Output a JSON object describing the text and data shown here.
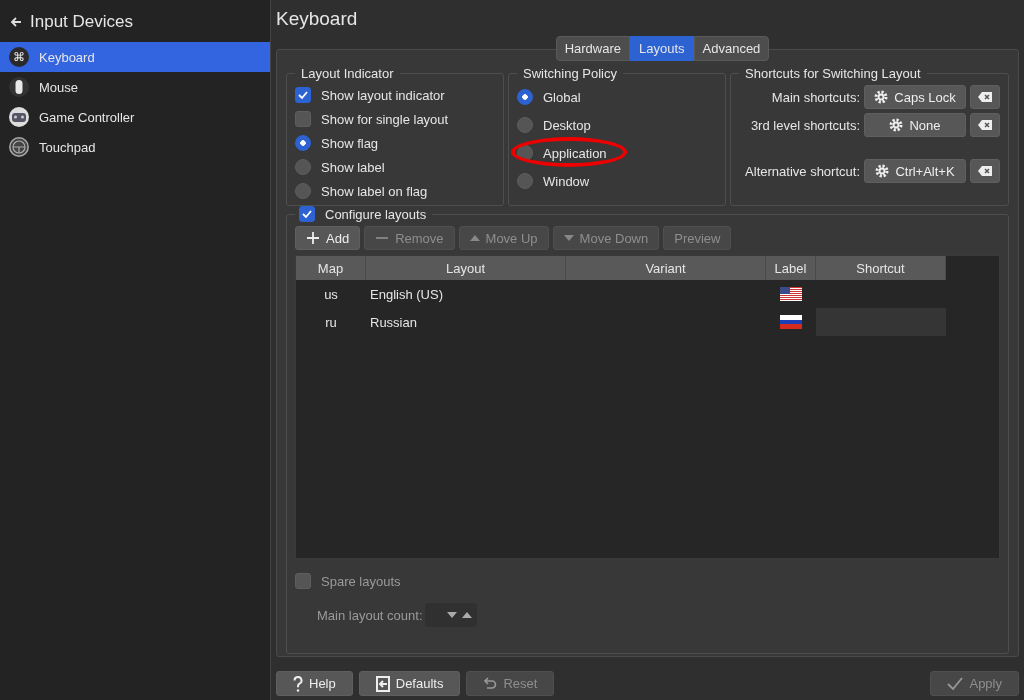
{
  "sidebar": {
    "back_title": "Input Devices",
    "items": [
      {
        "label": "Keyboard",
        "kind": "keyboard",
        "glyph": "⌘",
        "selected": true
      },
      {
        "label": "Mouse",
        "kind": "mouse",
        "selected": false
      },
      {
        "label": "Game Controller",
        "kind": "gamepad",
        "selected": false
      },
      {
        "label": "Touchpad",
        "kind": "touchpad",
        "selected": false
      }
    ]
  },
  "page_title": "Keyboard",
  "tabs": [
    {
      "label": "Hardware",
      "selected": false
    },
    {
      "label": "Layouts",
      "selected": true
    },
    {
      "label": "Advanced",
      "selected": false
    }
  ],
  "layout_indicator": {
    "title": "Layout Indicator",
    "options": [
      {
        "kind": "checkbox",
        "label": "Show layout indicator",
        "checked": true
      },
      {
        "kind": "checkbox",
        "label": "Show for single layout",
        "checked": false
      },
      {
        "kind": "radio",
        "label": "Show flag",
        "checked": true
      },
      {
        "kind": "radio",
        "label": "Show label",
        "checked": false
      },
      {
        "kind": "radio",
        "label": "Show label on flag",
        "checked": false
      }
    ]
  },
  "switching_policy": {
    "title": "Switching Policy",
    "options": [
      {
        "label": "Global",
        "selected": true,
        "circled": false
      },
      {
        "label": "Desktop",
        "selected": false,
        "circled": false
      },
      {
        "label": "Application",
        "selected": false,
        "circled": true
      },
      {
        "label": "Window",
        "selected": false,
        "circled": false
      }
    ]
  },
  "shortcuts": {
    "title": "Shortcuts for Switching Layout",
    "rows": [
      {
        "label": "Main shortcuts:",
        "value": "Caps Lock"
      },
      {
        "label": "3rd level shortcuts:",
        "value": "None"
      },
      {
        "label": "Alternative shortcut:",
        "value": "Ctrl+Alt+K"
      }
    ]
  },
  "configure_layouts": {
    "label": "Configure layouts",
    "checked": true,
    "buttons": [
      {
        "label": "Add",
        "kind": "plus",
        "disabled": false
      },
      {
        "label": "Remove",
        "kind": "minus",
        "disabled": true
      },
      {
        "label": "Move Up",
        "kind": "up",
        "disabled": true
      },
      {
        "label": "Move Down",
        "kind": "down",
        "disabled": true
      },
      {
        "label": "Preview",
        "kind": "none",
        "disabled": true
      }
    ],
    "columns": [
      "Map",
      "Layout",
      "Variant",
      "Label",
      "Shortcut"
    ],
    "rows": [
      {
        "map": "us",
        "layout": "English (US)",
        "kind": "us",
        "shortcut_field": false
      },
      {
        "map": "ru",
        "layout": "Russian",
        "kind": "ru",
        "shortcut_field": true
      }
    ],
    "spare_layouts": {
      "label": "Spare layouts",
      "checked": false
    },
    "main_layout_count": {
      "label": "Main layout count:",
      "disabled": true
    }
  },
  "footer": {
    "left": [
      {
        "label": "Help",
        "kind": "help",
        "disabled": false
      },
      {
        "label": "Defaults",
        "kind": "defaults",
        "disabled": false
      },
      {
        "label": "Reset",
        "kind": "reset",
        "disabled": true
      }
    ],
    "right": [
      {
        "label": "Apply",
        "kind": "check",
        "disabled": true
      }
    ]
  }
}
